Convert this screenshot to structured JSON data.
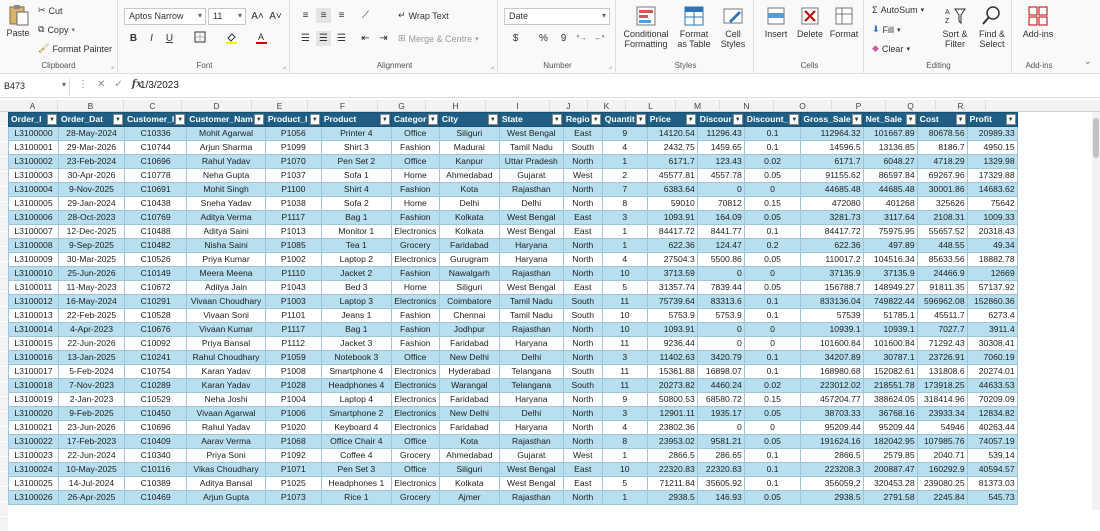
{
  "ribbon": {
    "clipboard": {
      "paste": "Paste",
      "cut": "Cut",
      "copy": "Copy",
      "format_painter": "Format Painter",
      "label": "Clipboard"
    },
    "font": {
      "name": "Aptos Narrow",
      "size": "11",
      "label": "Font",
      "bold": "B",
      "italic": "I",
      "underline": "U",
      "grow": "A˄",
      "shrink": "A˅"
    },
    "alignment": {
      "wrap": "Wrap Text",
      "merge": "Merge & Centre",
      "label": "Alignment"
    },
    "number": {
      "format": "Date",
      "currency": "$",
      "percent": "%",
      "comma": "9",
      "label": "Number"
    },
    "styles": {
      "conditional": "Conditional Formatting",
      "format_table": "Format as Table",
      "cell_styles": "Cell Styles",
      "label": "Styles"
    },
    "cells": {
      "insert": "Insert",
      "delete": "Delete",
      "format": "Format",
      "label": "Cells"
    },
    "editing": {
      "autosum": "AutoSum",
      "fill": "Fill",
      "clear": "Clear",
      "sort": "Sort & Filter",
      "find": "Find & Select",
      "label": "Editing"
    },
    "addins": {
      "addins": "Add-ins",
      "label": "Add-ins"
    }
  },
  "formula_bar": {
    "name_box": "B473",
    "fx": "fx",
    "value": "1/3/2023"
  },
  "columns": [
    "A",
    "B",
    "C",
    "D",
    "E",
    "F",
    "G",
    "H",
    "I",
    "J",
    "K",
    "L",
    "M",
    "N",
    "O",
    "P",
    "Q",
    "R"
  ],
  "headers": [
    "Order_I",
    "Order_Dat",
    "Customer_I",
    "Customer_Nam",
    "Product_I",
    "Product",
    "Categor",
    "City",
    "State",
    "Regio",
    "Quantit",
    "Price",
    "Discour",
    "Discount_",
    "Gross_Sale",
    "Net_Sale",
    "Cost",
    "Profit"
  ],
  "rows": [
    [
      "L3100000",
      "28-May-2024",
      "C10336",
      "Mohit Agarwal",
      "P1056",
      "Printer 4",
      "Office",
      "Siliguri",
      "West Bengal",
      "East",
      "9",
      "14120.54",
      "11296.43",
      "0.1",
      "112964.32",
      "101667.89",
      "80678.56",
      "20989.33"
    ],
    [
      "L3100001",
      "29-Mar-2026",
      "C10744",
      "Arjun Sharma",
      "P1099",
      "Shirt 3",
      "Fashion",
      "Madurai",
      "Tamil Nadu",
      "South",
      "4",
      "2432.75",
      "1459.65",
      "0.1",
      "14596.5",
      "13136.85",
      "8186.7",
      "4950.15"
    ],
    [
      "L3100002",
      "23-Feb-2024",
      "C10696",
      "Rahul Yadav",
      "P1070",
      "Pen Set 2",
      "Office",
      "Kanpur",
      "Uttar Pradesh",
      "North",
      "1",
      "6171.7",
      "123.43",
      "0.02",
      "6171.7",
      "6048.27",
      "4718.29",
      "1329.98"
    ],
    [
      "L3100003",
      "30-Apr-2026",
      "C10778",
      "Neha Gupta",
      "P1037",
      "Sofa 1",
      "Home",
      "Ahmedabad",
      "Gujarat",
      "West",
      "2",
      "45577.81",
      "4557.78",
      "0.05",
      "91155.62",
      "86597.84",
      "69267.96",
      "17329.88"
    ],
    [
      "L3100004",
      "9-Nov-2025",
      "C10691",
      "Mohit Singh",
      "P1100",
      "Shirt 4",
      "Fashion",
      "Kota",
      "Rajasthan",
      "North",
      "7",
      "6383.64",
      "0",
      "0",
      "44685.48",
      "44685.48",
      "30001.86",
      "14683.62"
    ],
    [
      "L3100005",
      "29-Jan-2024",
      "C10438",
      "Sneha Yadav",
      "P1038",
      "Sofa 2",
      "Home",
      "Delhi",
      "Delhi",
      "North",
      "8",
      "59010",
      "70812",
      "0.15",
      "472080",
      "401268",
      "325626",
      "75642"
    ],
    [
      "L3100006",
      "28-Oct-2023",
      "C10769",
      "Aditya Verma",
      "P1117",
      "Bag 1",
      "Fashion",
      "Kolkata",
      "West Bengal",
      "East",
      "3",
      "1093.91",
      "164.09",
      "0.05",
      "3281.73",
      "3117.64",
      "2108.31",
      "1009.33"
    ],
    [
      "L3100007",
      "12-Dec-2025",
      "C10488",
      "Aditya Saini",
      "P1013",
      "Monitor 1",
      "Electronics",
      "Kolkata",
      "West Bengal",
      "East",
      "1",
      "84417.72",
      "8441.77",
      "0.1",
      "84417.72",
      "75975.95",
      "55657.52",
      "20318.43"
    ],
    [
      "L3100008",
      "9-Sep-2025",
      "C10482",
      "Nisha Saini",
      "P1085",
      "Tea 1",
      "Grocery",
      "Faridabad",
      "Haryana",
      "North",
      "1",
      "622.36",
      "124.47",
      "0.2",
      "622.36",
      "497.89",
      "448.55",
      "49.34"
    ],
    [
      "L3100009",
      "30-Mar-2025",
      "C10526",
      "Priya Kumar",
      "P1002",
      "Laptop 2",
      "Electronics",
      "Gurugram",
      "Haryana",
      "North",
      "4",
      "27504.3",
      "5500.86",
      "0.05",
      "110017.2",
      "104516.34",
      "85633.56",
      "18882.78"
    ],
    [
      "L3100010",
      "25-Jun-2026",
      "C10149",
      "Meera Meena",
      "P1110",
      "Jacket 2",
      "Fashion",
      "Nawalgarh",
      "Rajasthan",
      "North",
      "10",
      "3713.59",
      "0",
      "0",
      "37135.9",
      "37135.9",
      "24466.9",
      "12669"
    ],
    [
      "L3100011",
      "11-May-2023",
      "C10672",
      "Aditya Jain",
      "P1043",
      "Bed 3",
      "Home",
      "Siliguri",
      "West Bengal",
      "East",
      "5",
      "31357.74",
      "7839.44",
      "0.05",
      "156788.7",
      "148949.27",
      "91811.35",
      "57137.92"
    ],
    [
      "L3100012",
      "16-May-2024",
      "C10291",
      "Vivaan Choudhary",
      "P1003",
      "Laptop 3",
      "Electronics",
      "Coimbatore",
      "Tamil Nadu",
      "South",
      "11",
      "75739.64",
      "83313.6",
      "0.1",
      "833136.04",
      "749822.44",
      "596962.08",
      "152860.36"
    ],
    [
      "L3100013",
      "22-Feb-2025",
      "C10528",
      "Vivaan Soni",
      "P1101",
      "Jeans 1",
      "Fashion",
      "Chennai",
      "Tamil Nadu",
      "South",
      "10",
      "5753.9",
      "5753.9",
      "0.1",
      "57539",
      "51785.1",
      "45511.7",
      "6273.4"
    ],
    [
      "L3100014",
      "4-Apr-2023",
      "C10676",
      "Vivaan Kumar",
      "P1117",
      "Bag 1",
      "Fashion",
      "Jodhpur",
      "Rajasthan",
      "North",
      "10",
      "1093.91",
      "0",
      "0",
      "10939.1",
      "10939.1",
      "7027.7",
      "3911.4"
    ],
    [
      "L3100015",
      "22-Jun-2026",
      "C10092",
      "Priya Bansal",
      "P1112",
      "Jacket 3",
      "Fashion",
      "Faridabad",
      "Haryana",
      "North",
      "11",
      "9236.44",
      "0",
      "0",
      "101600.84",
      "101600.84",
      "71292.43",
      "30308.41"
    ],
    [
      "L3100016",
      "13-Jan-2025",
      "C10241",
      "Rahul Choudhary",
      "P1059",
      "Notebook 3",
      "Office",
      "New Delhi",
      "Delhi",
      "North",
      "3",
      "11402.63",
      "3420.79",
      "0.1",
      "34207.89",
      "30787.1",
      "23726.91",
      "7060.19"
    ],
    [
      "L3100017",
      "5-Feb-2024",
      "C10754",
      "Karan Yadav",
      "P1008",
      "Smartphone 4",
      "Electronics",
      "Hyderabad",
      "Telangana",
      "South",
      "11",
      "15361.88",
      "16898.07",
      "0.1",
      "168980.68",
      "152082.61",
      "131808.6",
      "20274.01"
    ],
    [
      "L3100018",
      "7-Nov-2023",
      "C10289",
      "Karan Yadav",
      "P1028",
      "Headphones 4",
      "Electronics",
      "Warangal",
      "Telangana",
      "South",
      "11",
      "20273.82",
      "4460.24",
      "0.02",
      "223012.02",
      "218551.78",
      "173918.25",
      "44633.53"
    ],
    [
      "L3100019",
      "2-Jan-2023",
      "C10529",
      "Neha Joshi",
      "P1004",
      "Laptop 4",
      "Electronics",
      "Faridabad",
      "Haryana",
      "North",
      "9",
      "50800.53",
      "68580.72",
      "0.15",
      "457204.77",
      "388624.05",
      "318414.96",
      "70209.09"
    ],
    [
      "L3100020",
      "9-Feb-2025",
      "C10450",
      "Vivaan Agarwal",
      "P1006",
      "Smartphone 2",
      "Electronics",
      "New Delhi",
      "Delhi",
      "North",
      "3",
      "12901.11",
      "1935.17",
      "0.05",
      "38703.33",
      "36768.16",
      "23933.34",
      "12834.82"
    ],
    [
      "L3100021",
      "23-Jun-2026",
      "C10696",
      "Rahul Yadav",
      "P1020",
      "Keyboard 4",
      "Electronics",
      "Faridabad",
      "Haryana",
      "North",
      "4",
      "23802.36",
      "0",
      "0",
      "95209.44",
      "95209.44",
      "54946",
      "40263.44"
    ],
    [
      "L3100022",
      "17-Feb-2023",
      "C10409",
      "Aarav Verma",
      "P1068",
      "Office Chair 4",
      "Office",
      "Kota",
      "Rajasthan",
      "North",
      "8",
      "23953.02",
      "9581.21",
      "0.05",
      "191624.16",
      "182042.95",
      "107985.76",
      "74057.19"
    ],
    [
      "L3100023",
      "22-Jun-2024",
      "C10340",
      "Priya Soni",
      "P1092",
      "Coffee 4",
      "Grocery",
      "Ahmedabad",
      "Gujarat",
      "West",
      "1",
      "2866.5",
      "286.65",
      "0.1",
      "2866.5",
      "2579.85",
      "2040.71",
      "539.14"
    ],
    [
      "L3100024",
      "10-May-2025",
      "C10116",
      "Vikas Choudhary",
      "P1071",
      "Pen Set 3",
      "Office",
      "Siliguri",
      "West Bengal",
      "East",
      "10",
      "22320.83",
      "22320.83",
      "0.1",
      "223208.3",
      "200887.47",
      "160292.9",
      "40594.57"
    ],
    [
      "L3100025",
      "14-Jul-2024",
      "C10389",
      "Aditya Bansal",
      "P1025",
      "Headphones 1",
      "Electronics",
      "Kolkata",
      "West Bengal",
      "East",
      "5",
      "71211.84",
      "35605.92",
      "0.1",
      "356059.2",
      "320453.28",
      "239080.25",
      "81373.03"
    ],
    [
      "L3100026",
      "26-Apr-2025",
      "C10469",
      "Arjun Gupta",
      "P1073",
      "Rice 1",
      "Grocery",
      "Ajmer",
      "Rajasthan",
      "North",
      "1",
      "2938.5",
      "146.93",
      "0.05",
      "2938.5",
      "2791.58",
      "2245.84",
      "545.73"
    ]
  ],
  "colors": {
    "header_bg": "#1f5f86",
    "band": "#b8dff0",
    "border": "#9ec6d8"
  }
}
